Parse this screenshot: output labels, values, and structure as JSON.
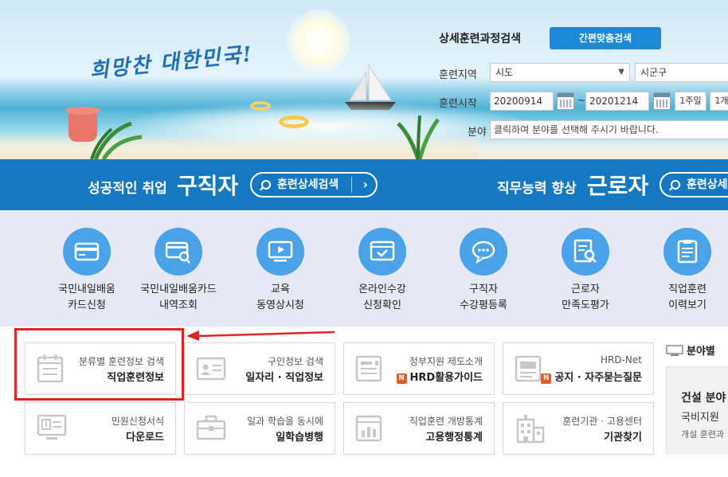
{
  "hero": {
    "slogan": "희망찬 대한민국!"
  },
  "search": {
    "title": "상세훈련과정검색",
    "quick_button": "간편맞춤검색",
    "region_label": "훈련지역",
    "region_select": "시도",
    "district_select": "시군구",
    "start_label": "훈련시작",
    "start_from": "20200914",
    "tilde": "~",
    "start_to": "20201214",
    "period_buttons": [
      "1주일",
      "1개"
    ],
    "field_label": "분야",
    "field_placeholder": "클릭하여 분야를 선택해 주시기 바랍니다."
  },
  "banner": {
    "left": {
      "sub": "성공적인 취업",
      "main": "구직자",
      "button": "훈련상세검색"
    },
    "right": {
      "sub": "직무능력 향상",
      "main": "근로자",
      "button": "훈련상세"
    }
  },
  "quick_icons": [
    {
      "line1": "국민내일배움",
      "line2": "카드신청",
      "icon": "card-icon"
    },
    {
      "line1": "국민내일배움카드",
      "line2": "내역조회",
      "icon": "card-search-icon"
    },
    {
      "line1": "교육",
      "line2": "동영상시청",
      "icon": "video-monitor-icon"
    },
    {
      "line1": "온라인수강",
      "line2": "신청확인",
      "icon": "online-check-icon"
    },
    {
      "line1": "구직자",
      "line2": "수강평등록",
      "icon": "speech-bubble-icon"
    },
    {
      "line1": "근로자",
      "line2": "만족도평가",
      "icon": "document-search-icon"
    },
    {
      "line1": "직업훈련",
      "line2": "이력보기",
      "icon": "clipboard-list-icon"
    }
  ],
  "tiles": [
    {
      "sub": "분류별 훈련정보 검색",
      "main": "직업훈련정보",
      "icon": "calendar-icon"
    },
    {
      "sub": "구인정보 검색",
      "main": "일자리 · 직업정보",
      "icon": "id-card-icon"
    },
    {
      "sub": "정부지원 제도소개",
      "main": "HRD활용가이드",
      "badge": "N",
      "icon": "guide-book-icon"
    },
    {
      "sub": "HRD-Net",
      "main": "공지 · 자주묻는질문",
      "badge": "N",
      "icon": "notice-board-icon"
    },
    {
      "sub": "민원신청서식",
      "main": "다운로드",
      "icon": "download-monitor-icon"
    },
    {
      "sub": "일과 학습을 동시에",
      "main": "일학습병행",
      "icon": "briefcase-icon"
    },
    {
      "sub": "직업훈련 개방통계",
      "main": "고용행정통계",
      "icon": "statistics-chart-icon"
    },
    {
      "sub": "훈련기관 · 고용센터",
      "main": "기관찾기",
      "icon": "building-icon"
    }
  ],
  "side": {
    "title": "분야별 ",
    "box_line1": "건설 분야",
    "box_line2": "국비지원",
    "box_line3": "개설 훈련과"
  },
  "colors": {
    "banner_blue": "#1578c2",
    "icon_blue": "#4aa3e8",
    "quick_button": "#1d8ad8",
    "highlight_red": "#e52222",
    "new_badge": "#e05a2a"
  }
}
